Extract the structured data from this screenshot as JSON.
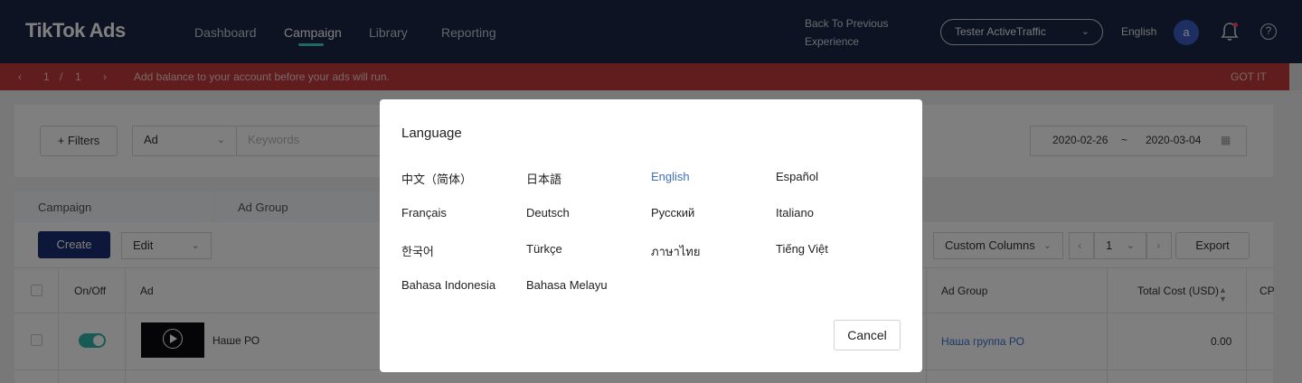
{
  "app": {
    "logo": "TikTok Ads"
  },
  "nav": {
    "items": [
      {
        "label": "Dashboard"
      },
      {
        "label": "Campaign"
      },
      {
        "label": "Library"
      },
      {
        "label": "Reporting"
      }
    ],
    "active": "Campaign"
  },
  "header": {
    "back_line1": "Back To Previous",
    "back_line2": "Experience",
    "account": "Tester ActiveTraffic",
    "language": "English",
    "avatar_initial": "a",
    "help_symbol": "?"
  },
  "alert": {
    "page_current": "1",
    "page_sep": "/",
    "page_total": "1",
    "message": "Add balance to your account before your ads will run.",
    "dismiss": "GOT IT",
    "color": "#c23a3d"
  },
  "toolbar": {
    "filters": "+ Filters",
    "level_select": "Ad",
    "keywords_placeholder": "Keywords",
    "date_start": "2020-02-26",
    "date_sep": "~",
    "date_end": "2020-03-04"
  },
  "tabs": [
    {
      "label": "Campaign"
    },
    {
      "label": "Ad Group"
    }
  ],
  "actions": {
    "create": "Create",
    "edit": "Edit",
    "custom_columns": "Custom Columns",
    "page_value": "1",
    "export": "Export"
  },
  "table": {
    "headers": {
      "onoff": "On/Off",
      "ad": "Ad",
      "ad_group": "Ad Group",
      "total_cost": "Total Cost (USD)",
      "cp": "CP"
    },
    "rows": [
      {
        "ad_name": "Наше РО",
        "ad_group": "Наша группа РО",
        "total_cost": "0.00",
        "status_on": true
      }
    ]
  },
  "modal": {
    "title": "Language",
    "options": [
      "中文（简体）",
      "日本語",
      "English",
      "Español",
      "Français",
      "Deutsch",
      "Русский",
      "Italiano",
      "한국어",
      "Türkçe",
      "ภาษาไทย",
      "Tiếng Việt",
      "Bahasa Indonesia",
      "Bahasa Melayu"
    ],
    "selected": "English",
    "cancel": "Cancel"
  },
  "colors": {
    "topbar": "#1b2744",
    "accent": "#3ad3c6",
    "primary_button": "#1b2f73",
    "link": "#3c6fd4",
    "selected_language": "#3f6fbf"
  },
  "icons": {
    "account_chevron": "chevron-down-icon",
    "bell": "bell-icon",
    "help": "help-icon",
    "calendar": "calendar-icon",
    "play": "play-icon"
  }
}
